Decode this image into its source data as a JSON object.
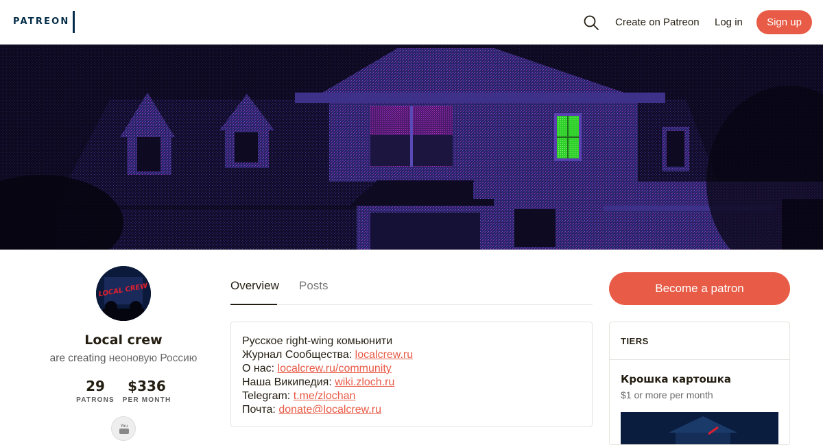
{
  "header": {
    "logo_text": "PATREON",
    "create_label": "Create on Patreon",
    "login_label": "Log in",
    "signup_label": "Sign up"
  },
  "banner": {
    "description_icon": "house-at-night-banner",
    "accent_color": "#3fe03a"
  },
  "avatar": {
    "text": "LOCAL CREW"
  },
  "creator": {
    "name": "Local crew",
    "creating_prefix": "are creating",
    "creating_what": "неоновую Россию",
    "patrons_count": "29",
    "patrons_label": "PATRONS",
    "earnings": "$336",
    "earnings_label": "PER MONTH",
    "social_icon": "youtube-icon"
  },
  "tabs": [
    {
      "label": "Overview",
      "active": true
    },
    {
      "label": "Posts",
      "active": false
    }
  ],
  "about": {
    "line1": "Русское right-wing комьюнити",
    "line2_prefix": "Журнал Сообщества: ",
    "line2_link": "localcrew.ru",
    "line3_prefix": "О нас: ",
    "line3_link": "localcrew.ru/community",
    "line4_prefix": "Наша Википедия: ",
    "line4_link": "wiki.zloch.ru",
    "line5_prefix": "Telegram: ",
    "line5_link": "t.me/zlochan",
    "line6_prefix": "Почта: ",
    "line6_link": "donate@localcrew.ru"
  },
  "cta": {
    "become_label": "Become a patron"
  },
  "tiers": {
    "heading": "TIERS",
    "items": [
      {
        "name": "Крошка картошка",
        "price": "$1 or more per month"
      }
    ]
  },
  "colors": {
    "brand": "#e85b46",
    "navy": "#052d49",
    "text": "#241e12"
  }
}
